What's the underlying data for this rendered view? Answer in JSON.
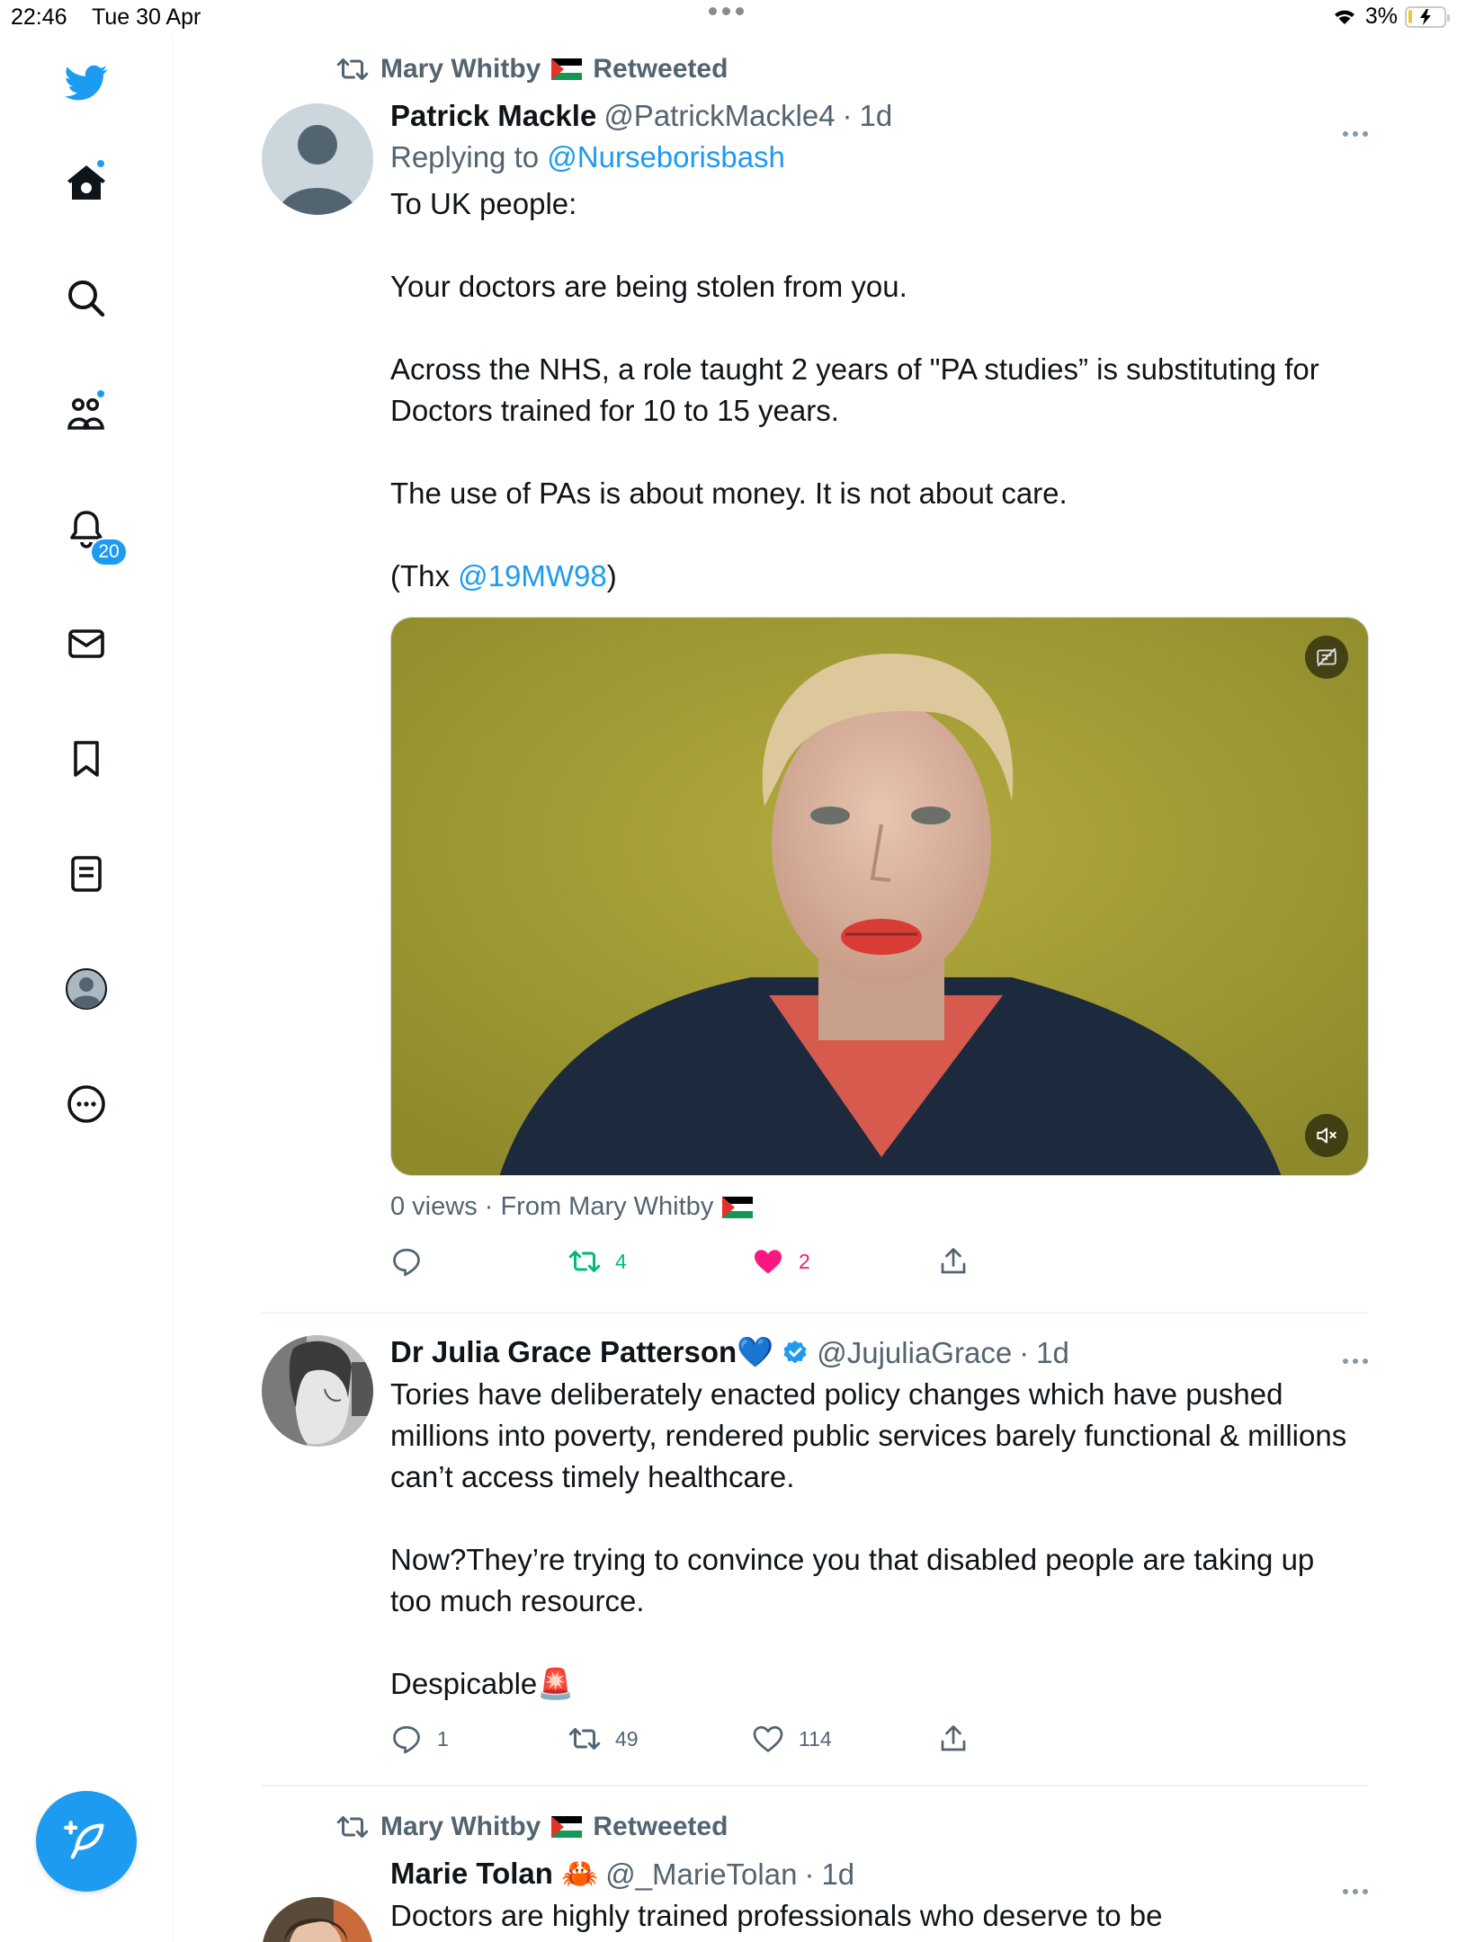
{
  "status_bar": {
    "time": "22:46",
    "date": "Tue 30 Apr",
    "battery": "3%"
  },
  "sidebar": {
    "notifications_count": "20"
  },
  "tweets": [
    {
      "retweeted_by": "Mary Whitby",
      "retweeted_label": "Retweeted",
      "name": "Patrick Mackle",
      "handle": "@PatrickMackle4",
      "time": "1d",
      "replying_prefix": "Replying to",
      "replying_to": "@Nurseborisbash",
      "body": [
        "To UK people:",
        "Your doctors are being stolen from you.",
        "Across the NHS, a role taught 2 years of  \"PA studies”  is substituting for Doctors trained for 10 to 15 years.",
        "The use of PAs is about money.  It is not about care."
      ],
      "thanks_prefix": "(Thx ",
      "thanks_handle": "@19MW98",
      "thanks_suffix": ")",
      "views": "0 views · From Mary Whitby",
      "retweets": "4",
      "likes": "2",
      "liked": true
    },
    {
      "name": "Dr Julia Grace Patterson💙",
      "handle": "@JujuliaGrace",
      "time": "1d",
      "body": [
        "Tories have deliberately enacted policy changes which have pushed millions into poverty, rendered public services barely functional & millions can’t access timely healthcare.",
        "Now?They’re trying to convince you that disabled people are taking up too much resource.",
        "Despicable🚨"
      ],
      "replies": "1",
      "retweets": "49",
      "likes": "114"
    },
    {
      "retweeted_by": "Mary Whitby",
      "retweeted_label": "Retweeted",
      "name": "Marie Tolan 🦀",
      "handle": "@_MarieTolan",
      "time": "1d",
      "body": [
        "Doctors are highly trained professionals who deserve to be"
      ]
    }
  ]
}
